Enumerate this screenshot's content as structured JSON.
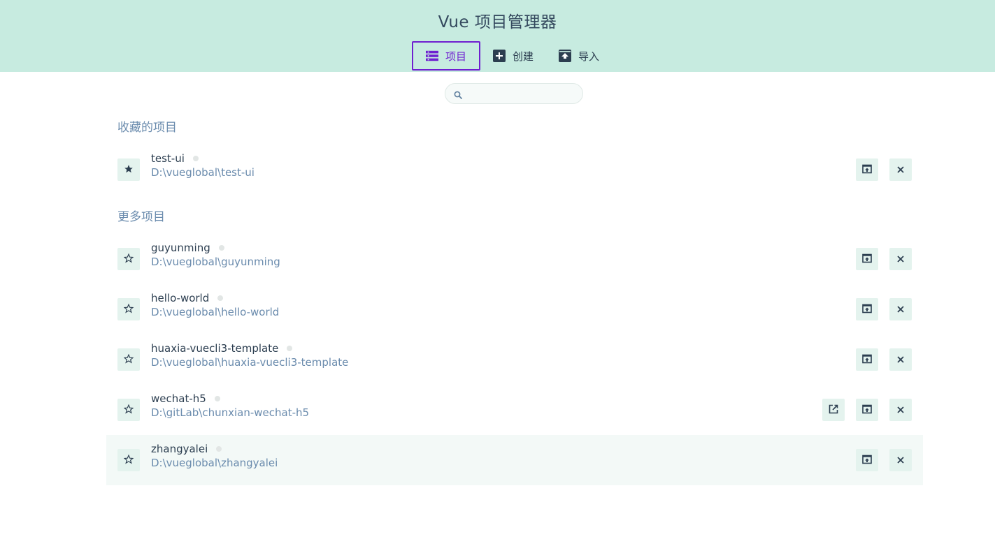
{
  "app": {
    "title": "Vue 项目管理器"
  },
  "tabs": [
    {
      "label": "项目",
      "icon": "list-icon",
      "active": true
    },
    {
      "label": "创建",
      "icon": "add-box-icon",
      "active": false
    },
    {
      "label": "导入",
      "icon": "unarchive-icon",
      "active": false
    }
  ],
  "search": {
    "placeholder": "",
    "value": ""
  },
  "sections": {
    "favorites_title": "收藏的项目",
    "more_title": "更多项目"
  },
  "favorites": [
    {
      "name": "test-ui",
      "path": "D:\\vueglobal\\test-ui",
      "starred": true
    }
  ],
  "projects": [
    {
      "name": "guyunming",
      "path": "D:\\vueglobal\\guyunming",
      "starred": false
    },
    {
      "name": "hello-world",
      "path": "D:\\vueglobal\\hello-world",
      "starred": false
    },
    {
      "name": "huaxia-vuecli3-template",
      "path": "D:\\vueglobal\\huaxia-vuecli3-template",
      "starred": false
    },
    {
      "name": "wechat-h5",
      "path": "D:\\gitLab\\chunxian-wechat-h5",
      "starred": false,
      "has_editor_button": true
    },
    {
      "name": "zhangyalei",
      "path": "D:\\vueglobal\\zhangyalei",
      "starred": false,
      "hovered": true
    }
  ],
  "colors": {
    "header_bg": "#c7ebe0",
    "accent": "#6f1fd0",
    "muted_text": "#6a8bad",
    "button_bg": "#e4f3ee"
  }
}
